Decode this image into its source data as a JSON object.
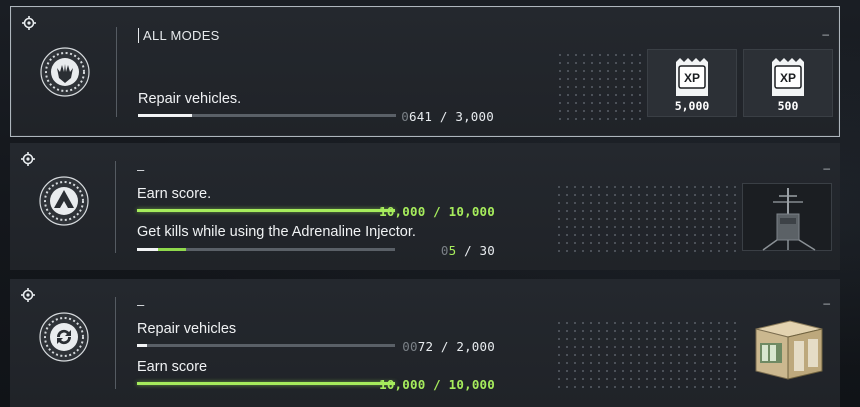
{
  "cards": [
    {
      "category": "ALL MODES",
      "dash": "–",
      "objectives": [
        {
          "label": "Repair vehicles.",
          "count_dim": "0",
          "count_current": "641",
          "count_sep": " / ",
          "count_total": "3,000",
          "progress": 0.21
        }
      ],
      "rewards": [
        {
          "icon": "xp-icon",
          "value": "5,000"
        },
        {
          "icon": "xp-icon",
          "value": "500"
        }
      ]
    },
    {
      "category": "–",
      "dash": "–",
      "objectives": [
        {
          "label": "Earn score.",
          "count_current": "10,000",
          "count_sep": " / ",
          "count_total": "10,000",
          "progress": 1.0,
          "complete": true
        },
        {
          "label": "Get kills while using the Adrenaline Injector.",
          "count_dim": "0",
          "count_current": "5",
          "count_sep": " / ",
          "count_total": "30",
          "progress": 0.17,
          "pending": 0.2
        }
      ],
      "rewards": [
        {
          "icon": "antenna-gadget-image"
        }
      ]
    },
    {
      "category": "–",
      "dash": "–",
      "objectives": [
        {
          "label": "Repair vehicles",
          "count_dim": "00",
          "count_current": "72",
          "count_sep": " / ",
          "count_total": "2,000",
          "progress": 0.04
        },
        {
          "label": "Earn score",
          "count_current": "10,000",
          "count_sep": " / ",
          "count_total": "10,000",
          "progress": 1.0,
          "complete": true
        }
      ],
      "rewards": [
        {
          "icon": "supply-crate-image"
        }
      ]
    }
  ],
  "colors": {
    "complete": "#a6ec5c",
    "progress": "#f2f4f5",
    "track": "#5a6067"
  }
}
